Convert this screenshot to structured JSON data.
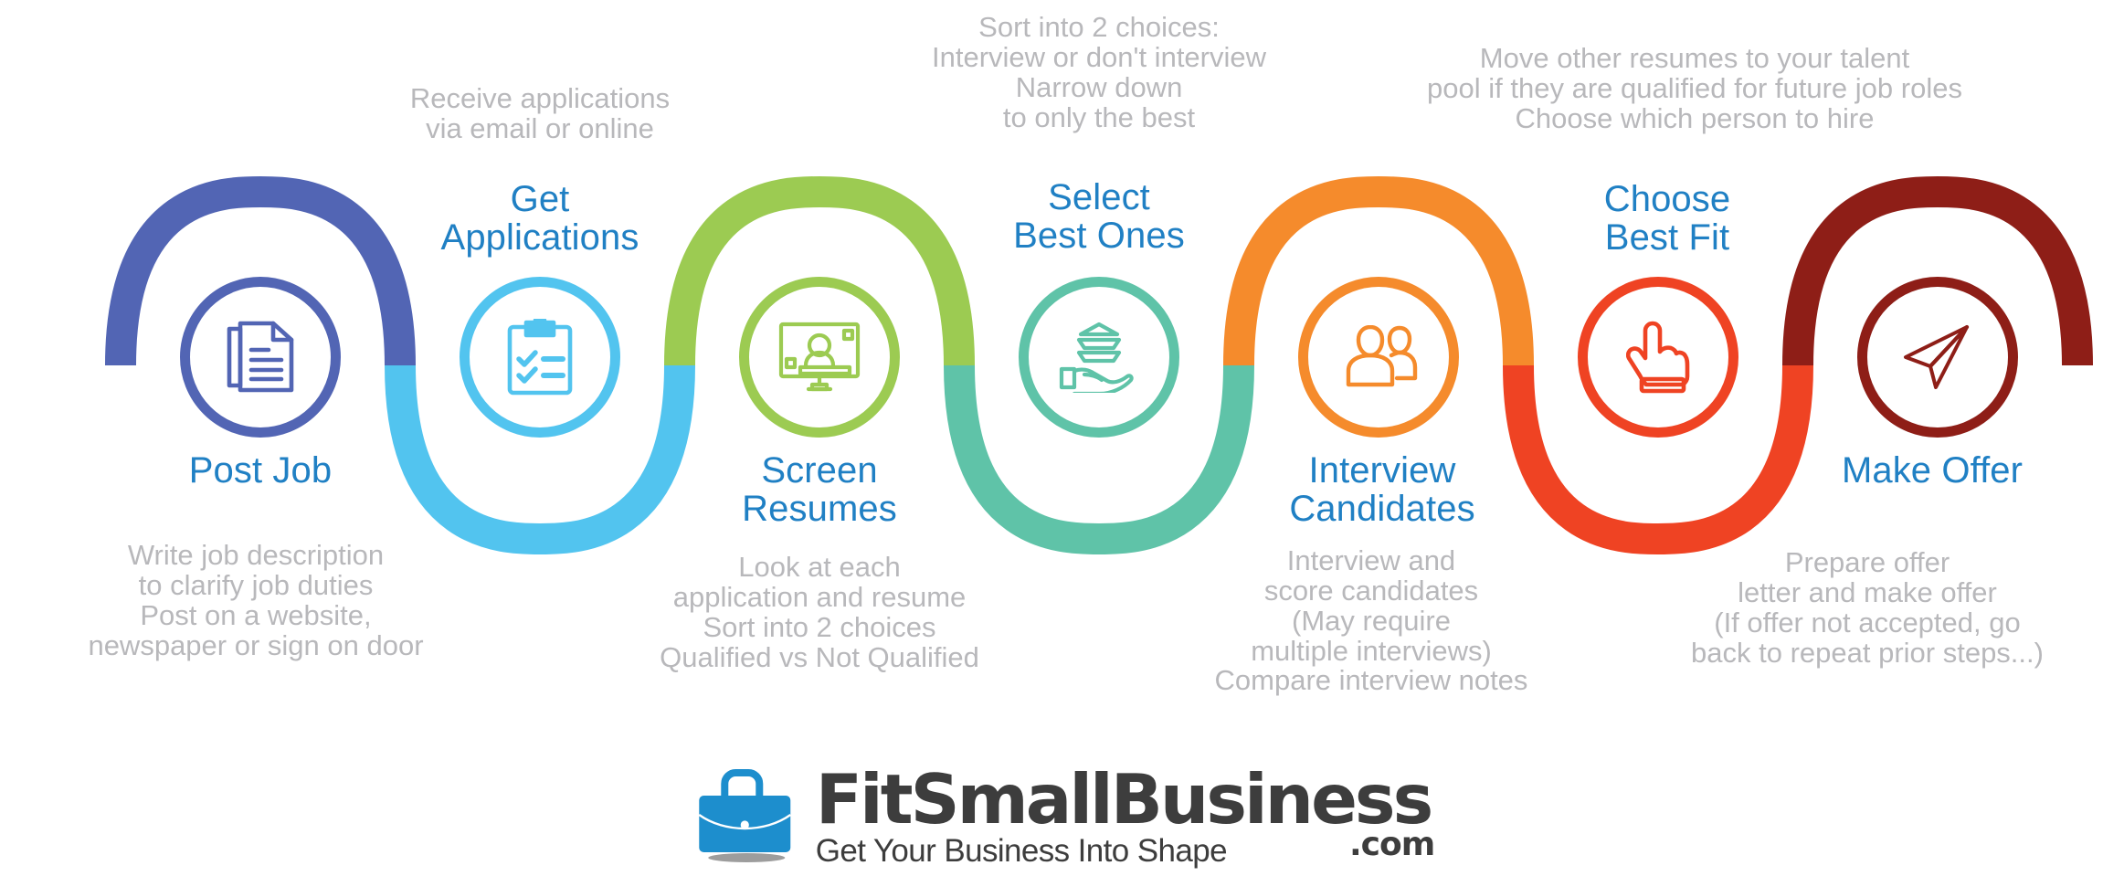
{
  "colors": {
    "title_blue": "#2080c4",
    "desc_gray": "#b8b8bb",
    "step1": "#5265b4",
    "step2": "#52c4ef",
    "step3": "#9ccb52",
    "step4": "#5fc3a8",
    "step5": "#f58b2c",
    "step6": "#ef4323",
    "step7": "#8e1e17",
    "logo_case": "#1d8ecd",
    "logo_text": "#3d3d3d"
  },
  "steps": [
    {
      "id": "post-job",
      "title": "Post Job",
      "title_position": "below",
      "description": "Write job description\nto clarify job duties\nPost on a website,\nnewspaper or sign on door",
      "description_position": "bottom",
      "icon": "document-icon",
      "color": "#5265b4"
    },
    {
      "id": "get-applications",
      "title": "Get\nApplications",
      "title_position": "above",
      "description": "Receive applications\nvia email or online",
      "description_position": "top",
      "icon": "clipboard-check-icon",
      "color": "#52c4ef"
    },
    {
      "id": "screen-resumes",
      "title": "Screen\nResumes",
      "title_position": "below",
      "description": "Look at each\napplication and resume\nSort into 2 choices\nQualified vs Not Qualified",
      "description_position": "bottom",
      "icon": "monitor-person-icon",
      "color": "#9ccb52"
    },
    {
      "id": "select-best-ones",
      "title": "Select\nBest Ones",
      "title_position": "above",
      "description": "Sort into 2 choices:\nInterview or don't interview\nNarrow down\nto only the best",
      "description_position": "top",
      "icon": "hand-papers-icon",
      "color": "#5fc3a8"
    },
    {
      "id": "interview-candidates",
      "title": "Interview\nCandidates",
      "title_position": "below",
      "description": "Interview and\nscore candidates\n(May require\nmultiple interviews)\nCompare interview notes",
      "description_position": "bottom",
      "icon": "two-people-icon",
      "color": "#f58b2c"
    },
    {
      "id": "choose-best-fit",
      "title": "Choose\nBest Fit",
      "title_position": "above",
      "description": "Move other resumes to your talent\npool if they are qualified for future job roles\nChoose which person to hire",
      "description_position": "top",
      "icon": "pointing-hand-icon",
      "color": "#ef4323"
    },
    {
      "id": "make-offer",
      "title": "Make Offer",
      "title_position": "below",
      "description": "Prepare offer\nletter and make offer\n(If offer not accepted, go\nback to repeat prior steps...)",
      "description_position": "bottom",
      "icon": "paper-plane-icon",
      "color": "#8e1e17"
    }
  ],
  "logo": {
    "icon": "briefcase-icon",
    "brand": "FitSmallBusiness",
    "dotcom": ".com",
    "tagline": "Get Your Business Into Shape"
  }
}
